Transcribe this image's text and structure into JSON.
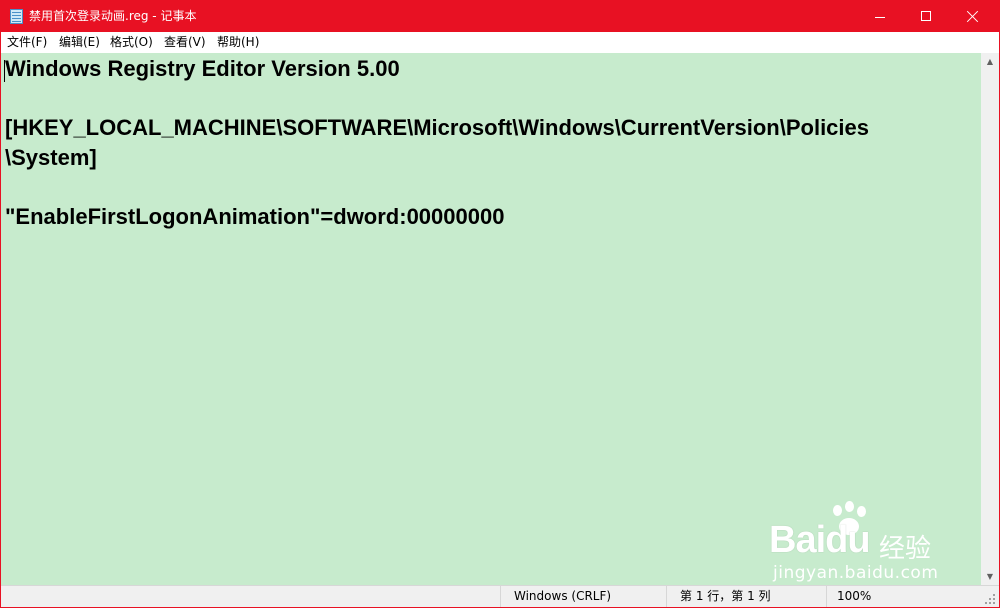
{
  "window": {
    "title": "禁用首次登录动画.reg - 记事本",
    "accent_color": "#e81123",
    "editor_background": "#c7ebcd"
  },
  "menu": {
    "items": [
      {
        "label": "文件(F)"
      },
      {
        "label": "编辑(E)"
      },
      {
        "label": "格式(O)"
      },
      {
        "label": "查看(V)"
      },
      {
        "label": "帮助(H)"
      }
    ]
  },
  "editor": {
    "lines": [
      "Windows Registry Editor Version 5.00",
      "[HKEY_LOCAL_MACHINE\\SOFTWARE\\Microsoft\\Windows\\CurrentVersion\\Policies",
      "\\System]",
      "\"EnableFirstLogonAnimation\"=dword:00000000"
    ]
  },
  "status": {
    "line_ending": "Windows (CRLF)",
    "cursor_position": "第 1 行，第 1 列",
    "zoom": "100%"
  },
  "watermark": {
    "logo_text": "Bai",
    "logo_text_2": "du",
    "logo_sub": "经验",
    "url": "jingyan.baidu.com"
  }
}
